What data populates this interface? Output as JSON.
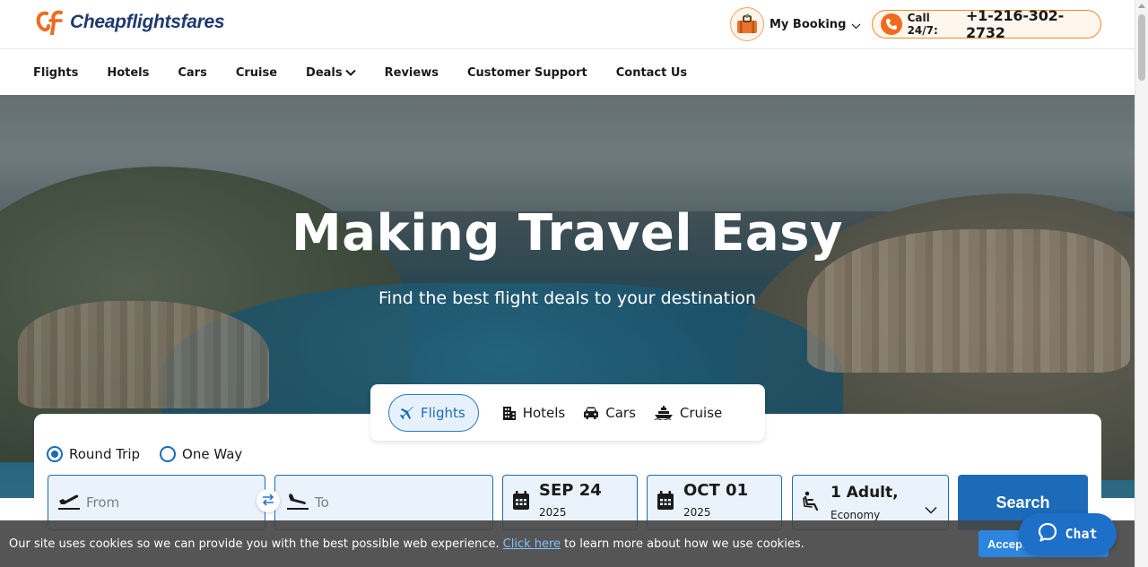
{
  "header": {
    "logo_text": "Cheapflightsfares",
    "my_booking_label": "My Booking",
    "call_prefix": "Call 24/7:",
    "call_number": "+1-216-302-2732"
  },
  "nav": {
    "items": [
      {
        "label": "Flights"
      },
      {
        "label": "Hotels"
      },
      {
        "label": "Cars"
      },
      {
        "label": "Cruise"
      },
      {
        "label": "Deals"
      },
      {
        "label": "Reviews"
      },
      {
        "label": "Customer Support"
      },
      {
        "label": "Contact Us"
      }
    ]
  },
  "hero": {
    "title": "Making Travel Easy",
    "subtitle": "Find the best flight deals to your destination"
  },
  "product_tabs": {
    "items": [
      {
        "label": "Flights",
        "active": true
      },
      {
        "label": "Hotels",
        "active": false
      },
      {
        "label": "Cars",
        "active": false
      },
      {
        "label": "Cruise",
        "active": false
      }
    ]
  },
  "search": {
    "trip_types": [
      {
        "label": "Round Trip",
        "selected": true
      },
      {
        "label": "One Way",
        "selected": false
      }
    ],
    "from_placeholder": "From",
    "to_placeholder": "To",
    "depart": {
      "date": "SEP 24",
      "year": "2025"
    },
    "return": {
      "date": "OCT 01",
      "year": "2025"
    },
    "passengers": {
      "count": "1 Adult,",
      "cabin": "Economy"
    },
    "search_label": "Search"
  },
  "cookie": {
    "text_before": "Our site uses cookies so we can provide you with the best possible web experience.",
    "link_text": "Click here",
    "text_after": "to learn more about how we use cookies.",
    "accept_label": "Accept"
  },
  "chat": {
    "label": "Chat"
  },
  "colors": {
    "brand_blue": "#1c6bb8",
    "brand_orange": "#f26b1d",
    "logo_navy": "#1f3a6e"
  }
}
